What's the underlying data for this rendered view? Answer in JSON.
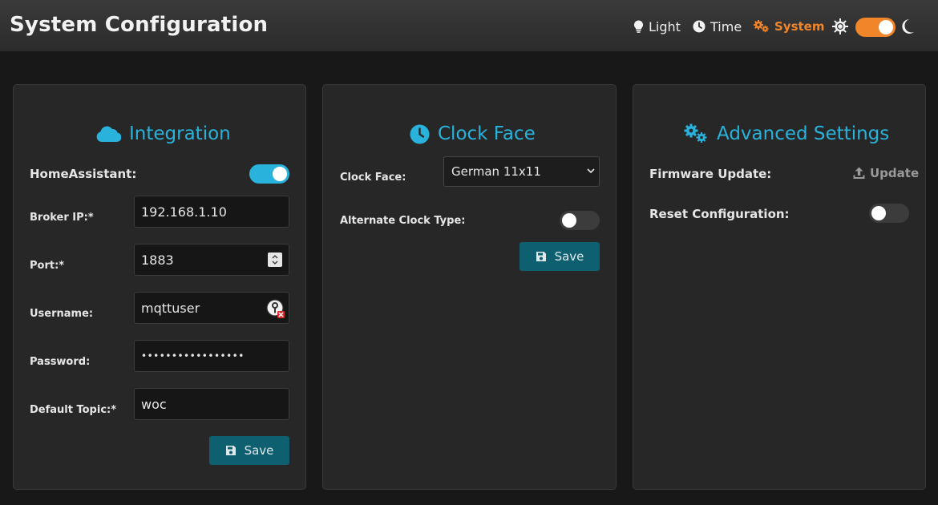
{
  "header": {
    "title": "System Configuration",
    "nav": {
      "light": "Light",
      "time": "Time",
      "system": "System"
    },
    "theme_toggle_on": true
  },
  "colors": {
    "accent": "#29b3dc",
    "active_nav": "#f0852a",
    "button": "#0e5f70"
  },
  "integration": {
    "title": "Integration",
    "icon": "cloud-icon",
    "homeassistant_label": "HomeAssistant:",
    "homeassistant_enabled": true,
    "broker_ip_label": "Broker IP:*",
    "broker_ip_value": "192.168.1.10",
    "port_label": "Port:*",
    "port_value": "1883",
    "username_label": "Username:",
    "username_value": "mqttuser",
    "password_label": "Password:",
    "password_value": "•••••••••••••••••",
    "default_topic_label": "Default Topic:*",
    "default_topic_value": "woc",
    "save_label": "Save"
  },
  "clock_face": {
    "title": "Clock Face",
    "icon": "clock-icon",
    "clock_face_label": "Clock Face:",
    "clock_face_selected": "German 11x11",
    "alternate_label": "Alternate Clock Type:",
    "alternate_enabled": false,
    "save_label": "Save"
  },
  "advanced": {
    "title": "Advanced Settings",
    "icon": "gears-icon",
    "firmware_label": "Firmware Update:",
    "update_label": "Update",
    "reset_label": "Reset Configuration:",
    "reset_enabled": false
  }
}
